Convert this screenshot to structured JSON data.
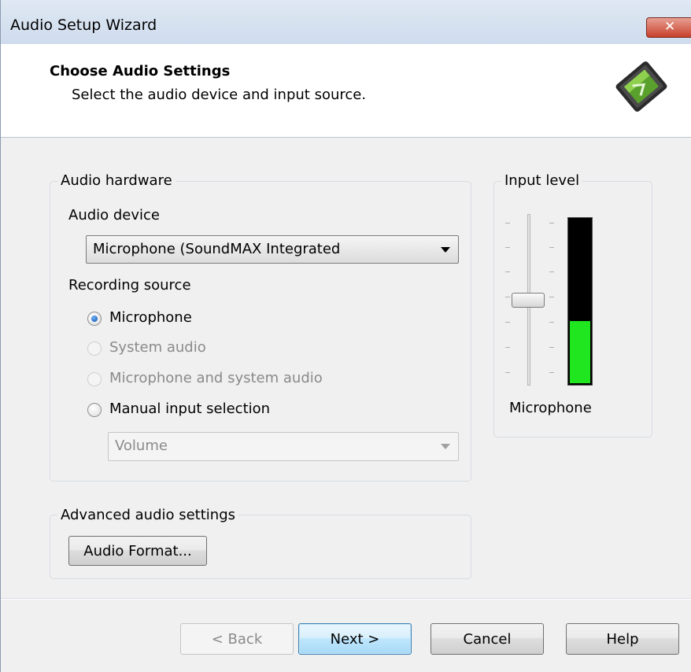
{
  "window": {
    "title": "Audio Setup Wizard",
    "close_glyph": "✕"
  },
  "header": {
    "title": "Choose Audio Settings",
    "subtitle": "Select the audio device and input source.",
    "logo_icon": "camtasia-logo-icon"
  },
  "audio_hardware": {
    "legend": "Audio hardware",
    "device_label": "Audio device",
    "device_value": "Microphone (SoundMAX Integrated",
    "recording_label": "Recording source",
    "sources": [
      {
        "label": "Microphone",
        "checked": true,
        "enabled": true
      },
      {
        "label": "System audio",
        "checked": false,
        "enabled": false
      },
      {
        "label": "Microphone and system audio",
        "checked": false,
        "enabled": false
      },
      {
        "label": "Manual input selection",
        "checked": false,
        "enabled": true
      }
    ],
    "manual_select_value": "Volume"
  },
  "input_level": {
    "legend": "Input level",
    "source_label": "Microphone",
    "meter_level_fraction": 0.38,
    "slider_position_fraction": 0.5,
    "meter_color": "#20e620"
  },
  "advanced": {
    "legend": "Advanced audio settings",
    "audio_format_button": "Audio Format..."
  },
  "footer": {
    "back": "< Back",
    "next": "Next >",
    "cancel": "Cancel",
    "help": "Help"
  }
}
